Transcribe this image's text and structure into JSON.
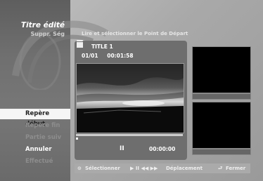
{
  "header": {
    "title": "Titre édité",
    "subtitle": "Suppr. Ség",
    "instruction": "Lire et sélectionner le Point de Départ"
  },
  "menu": {
    "items": [
      {
        "label": "Repère début",
        "state": "active"
      },
      {
        "label": "Repère fin",
        "state": "disabled"
      },
      {
        "label": "Partie suiv",
        "state": "disabled"
      },
      {
        "label": "Annuler",
        "state": "normal"
      },
      {
        "label": "Effectué",
        "state": "disabled"
      }
    ]
  },
  "player": {
    "title": "TITLE 1",
    "chapter": "01/01",
    "duration": "00:01:58",
    "state_icon": "pause-icon",
    "state_glyph": "II",
    "timecode": "00:00:00",
    "progress": 0.0
  },
  "bottom_bar": {
    "select_label": "Sélectionner",
    "move_label": "Déplacement",
    "close_label": "Fermer",
    "select_glyph": "⊙",
    "move_glyph": "▶ II ◀◀ ▶▶",
    "close_glyph": "⮐"
  },
  "colors": {
    "active_bg": "#f5f5f5",
    "disabled_text": "#8d8d8d",
    "panel_bg": "#6e6e6e"
  }
}
